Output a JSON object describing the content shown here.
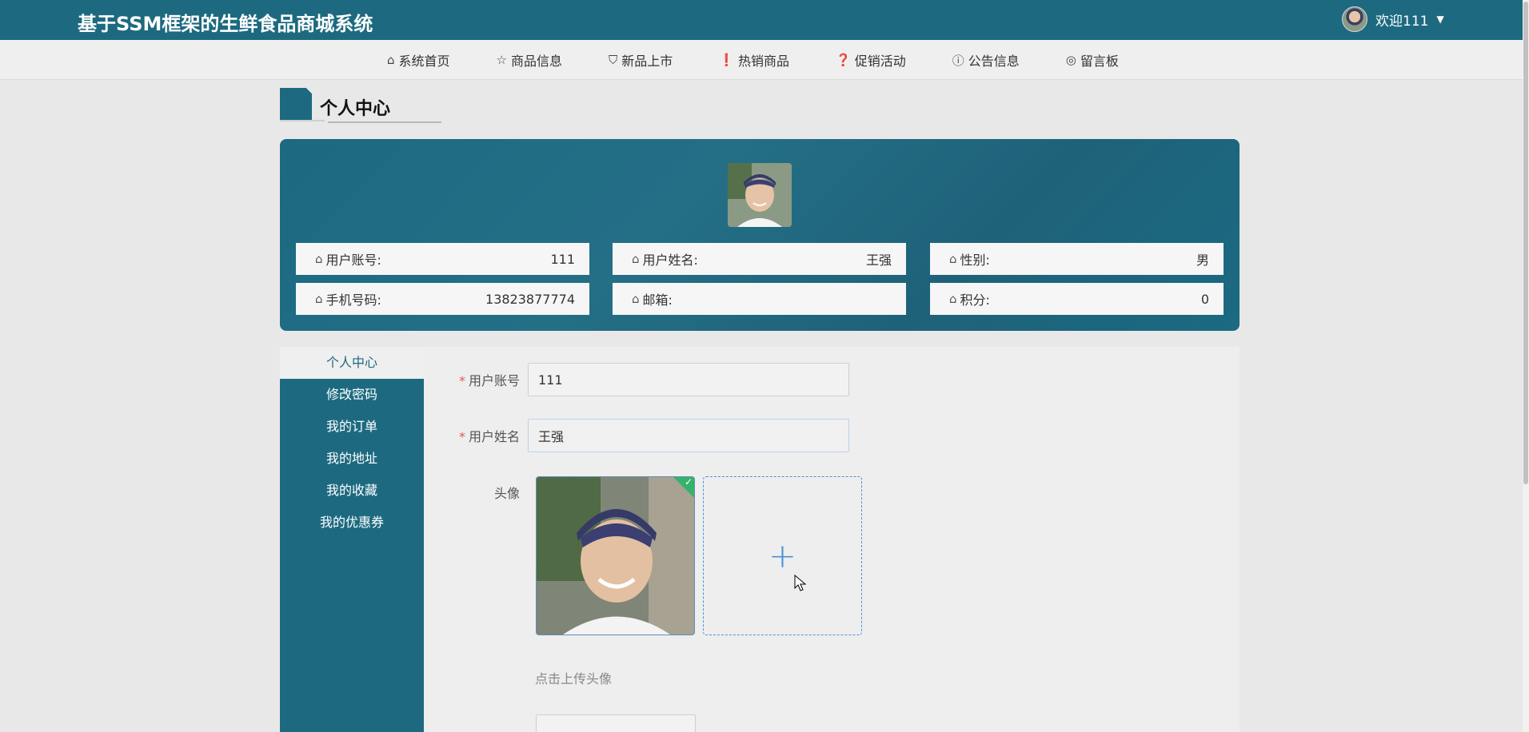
{
  "header": {
    "title": "基于SSM框架的生鲜食品商城系统",
    "welcome": "欢迎111"
  },
  "nav": [
    {
      "label": "系统首页",
      "icon": "home-icon"
    },
    {
      "label": "商品信息",
      "icon": "star-icon"
    },
    {
      "label": "新品上市",
      "icon": "bag-icon"
    },
    {
      "label": "热销商品",
      "icon": "alert-icon"
    },
    {
      "label": "促销活动",
      "icon": "question-icon"
    },
    {
      "label": "公告信息",
      "icon": "info-icon"
    },
    {
      "label": "留言板",
      "icon": "message-icon"
    }
  ],
  "section": {
    "title": "个人中心"
  },
  "profile": {
    "username_label": "用户账号:",
    "username_value": "111",
    "realname_label": "用户姓名:",
    "realname_value": "王强",
    "gender_label": "性别:",
    "gender_value": "男",
    "phone_label": "手机号码:",
    "phone_value": "13823877774",
    "email_label": "邮箱:",
    "email_value": "",
    "points_label": "积分:",
    "points_value": "0"
  },
  "sidebar": [
    {
      "label": "个人中心",
      "active": true
    },
    {
      "label": "修改密码"
    },
    {
      "label": "我的订单"
    },
    {
      "label": "我的地址"
    },
    {
      "label": "我的收藏"
    },
    {
      "label": "我的优惠券"
    }
  ],
  "form": {
    "username_label": "用户账号",
    "username_value": "111",
    "realname_label": "用户姓名",
    "realname_value": "王强",
    "avatar_label": "头像",
    "avatar_hint": "点击上传头像"
  },
  "colors": {
    "primary": "#1d6a80",
    "upload_border": "#4a90d9",
    "success": "#35b36a",
    "required": "#e35a5a"
  }
}
